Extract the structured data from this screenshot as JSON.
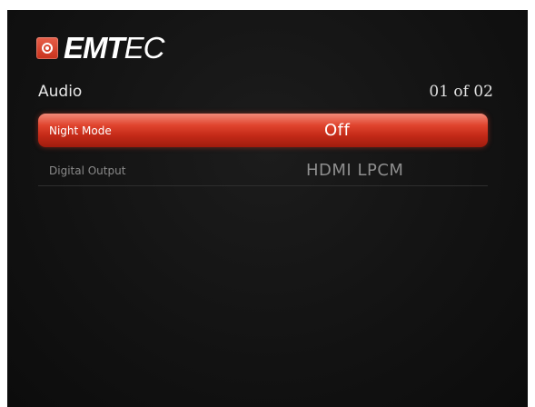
{
  "brand": {
    "logo_icon": "emtec-speaker-icon",
    "name_bold": "EMT",
    "name_light": "EC",
    "accent_color": "#d8361f"
  },
  "header": {
    "title": "Audio",
    "page_indicator": "01 of 02"
  },
  "settings": [
    {
      "label": "Night Mode",
      "value": "Off",
      "selected": true
    },
    {
      "label": "Digital Output",
      "value": "HDMI LPCM",
      "selected": false
    }
  ]
}
